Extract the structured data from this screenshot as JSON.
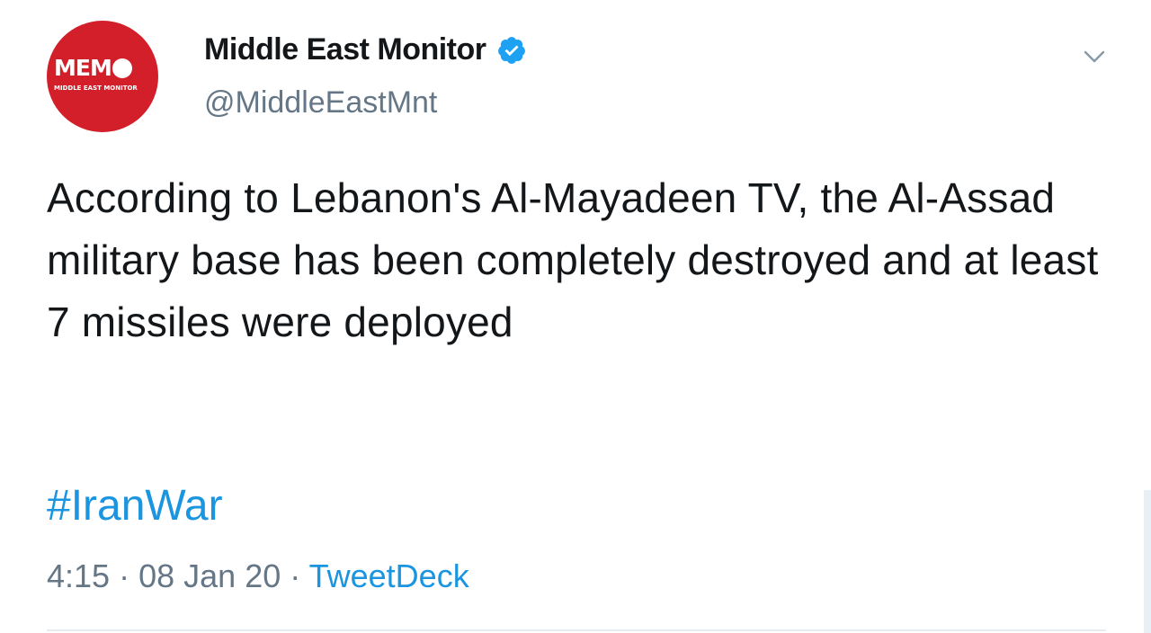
{
  "account": {
    "avatar_logo_text": "MEMO",
    "avatar_logo_subtext": "MIDDLE EAST MONITOR",
    "display_name": "Middle East Monitor",
    "handle": "@MiddleEastMnt",
    "verified_icon": "verified-badge-icon"
  },
  "tweet": {
    "text": "According to Lebanon's Al-Mayadeen TV, the Al-Assad military base has been completely destroyed and at least 7 missiles were deployed",
    "hashtag": "#IranWar",
    "time": "4:15",
    "date": "08 Jan 20",
    "separator": "·",
    "source": "TweetDeck"
  },
  "menu": {
    "icon": "chevron-down-icon"
  },
  "colors": {
    "brand_red": "#d21f2a",
    "link_blue": "#1b95e0",
    "verified_blue": "#1da1f2",
    "text_primary": "#14171a",
    "text_secondary": "#657786"
  }
}
